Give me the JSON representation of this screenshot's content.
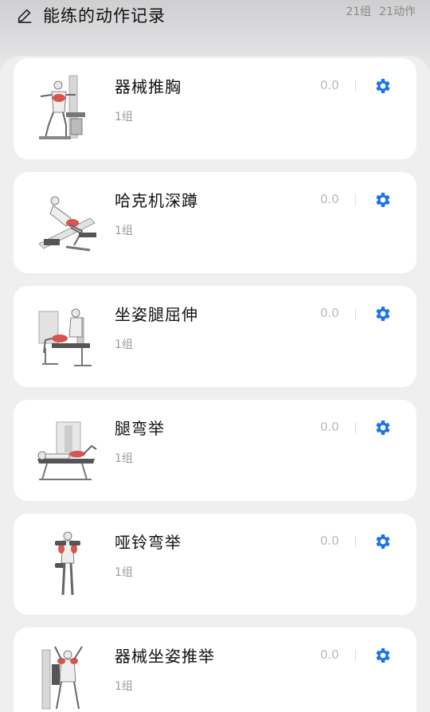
{
  "header": {
    "title": "能练的动作记录",
    "sets_total": "21组",
    "actions_total": "21动作",
    "edit_icon": "pencil-icon"
  },
  "colors": {
    "accent": "#1a73e8",
    "muscle_highlight": "#d9534f"
  },
  "exercises": [
    {
      "name": "器械推胸",
      "sets": "1组",
      "value": "0.0",
      "icon": "gear-icon"
    },
    {
      "name": "哈克机深蹲",
      "sets": "1组",
      "value": "0.0",
      "icon": "gear-icon"
    },
    {
      "name": "坐姿腿屈伸",
      "sets": "1组",
      "value": "0.0",
      "icon": "gear-icon"
    },
    {
      "name": "腿弯举",
      "sets": "1组",
      "value": "0.0",
      "icon": "gear-icon"
    },
    {
      "name": "哑铃弯举",
      "sets": "1组",
      "value": "0.0",
      "icon": "gear-icon"
    },
    {
      "name": "器械坐姿推举",
      "sets": "1组",
      "value": "0.0",
      "icon": "gear-icon"
    }
  ]
}
